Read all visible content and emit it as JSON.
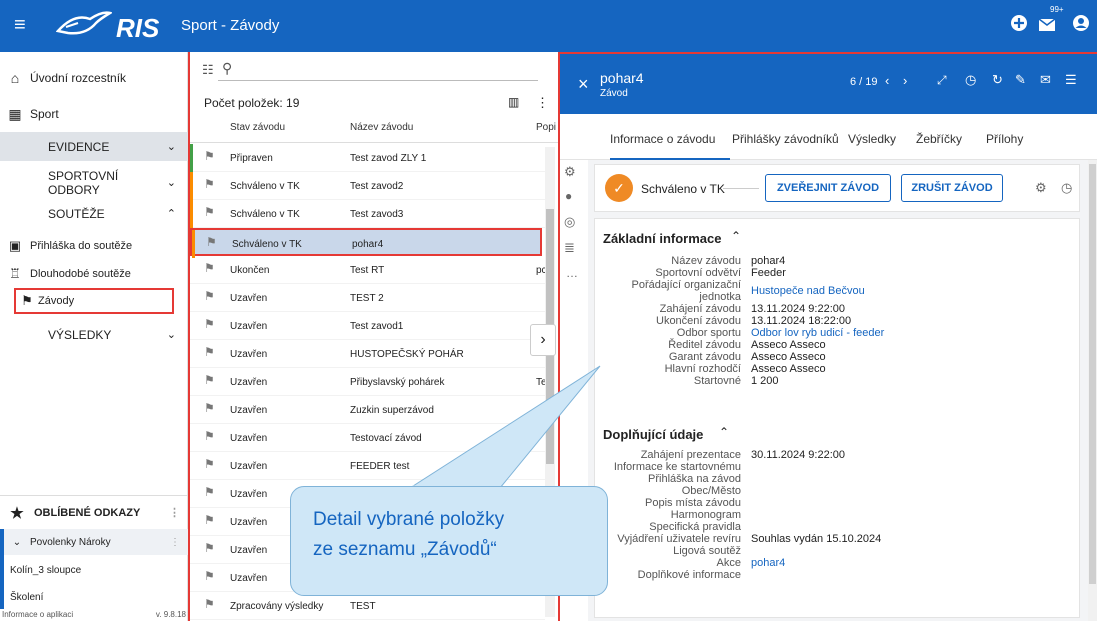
{
  "topbar": {
    "app_name": "RIS",
    "title": "Sport - Závody",
    "notif_count": "99+"
  },
  "sidebar": {
    "items": [
      {
        "label": "Úvodní rozcestník"
      },
      {
        "label": "Sport"
      }
    ],
    "sections": [
      {
        "label": "EVIDENCE"
      },
      {
        "label": "SPORTOVNÍ ODBORY"
      },
      {
        "label": "SOUTĚŽE"
      }
    ],
    "subitems": [
      {
        "label": "Přihláška do soutěže"
      },
      {
        "label": "Dlouhodobé soutěže"
      },
      {
        "label": "Závody"
      }
    ],
    "results": "VÝSLEDKY",
    "favorites": "OBLÍBENÉ ODKAZY",
    "fav_items": [
      {
        "label": "Povolenky Nároky"
      },
      {
        "label": "Kolín_3 sloupce"
      },
      {
        "label": "Školení"
      }
    ],
    "footer_left": "Informace o aplikaci",
    "footer_right": "v. 9.8.18"
  },
  "list": {
    "count": "Počet položek: 19",
    "col_status": "Stav závodu",
    "col_name": "Název závodu",
    "col_desc": "Popi",
    "rows": [
      {
        "status": "Připraven",
        "name": "Test zavod ZLY 1",
        "desc": ""
      },
      {
        "status": "Schváleno v TK",
        "name": "Test zavod2",
        "desc": ""
      },
      {
        "status": "Schváleno v TK",
        "name": "Test zavod3",
        "desc": ""
      },
      {
        "status": "Schváleno v TK",
        "name": "pohar4",
        "desc": ""
      },
      {
        "status": "Ukončen",
        "name": "Test RT",
        "desc": "pc"
      },
      {
        "status": "Uzavřen",
        "name": "TEST 2",
        "desc": ""
      },
      {
        "status": "Uzavřen",
        "name": "Test zavod1",
        "desc": ""
      },
      {
        "status": "Uzavřen",
        "name": "HUSTOPEČSKÝ POHÁR",
        "desc": ""
      },
      {
        "status": "Uzavřen",
        "name": "Přibyslavský pohárek",
        "desc": "Te"
      },
      {
        "status": "Uzavřen",
        "name": "Zuzkin superzávod",
        "desc": ""
      },
      {
        "status": "Uzavřen",
        "name": "Testovací závod",
        "desc": ""
      },
      {
        "status": "Uzavřen",
        "name": "FEEDER test",
        "desc": ""
      },
      {
        "status": "Uzavřen",
        "name": "",
        "desc": ""
      },
      {
        "status": "Uzavřen",
        "name": "",
        "desc": ""
      },
      {
        "status": "Uzavřen",
        "name": "",
        "desc": ""
      },
      {
        "status": "Uzavřen",
        "name": "",
        "desc": ""
      },
      {
        "status": "Zpracovány výsledky",
        "name": "TEST",
        "desc": ""
      }
    ],
    "status_colors": [
      "#43a047",
      "#fb8c00",
      "#fb8c00",
      "#fb8c00"
    ]
  },
  "detail": {
    "title": "pohar4",
    "subtitle": "Závod",
    "pager": "6 / 19",
    "tabs": [
      {
        "label": "Informace o závodu"
      },
      {
        "label": "Přihlášky závodníků"
      },
      {
        "label": "Výsledky"
      },
      {
        "label": "Žebříčky"
      },
      {
        "label": "Přílohy"
      }
    ],
    "status": "Schváleno v TK",
    "btn_publish": "ZVEŘEJNIT ZÁVOD",
    "btn_cancel": "ZRUŠIT ZÁVOD",
    "basic_title": "Základní informace",
    "basic": [
      {
        "k": "Název závodu",
        "v": "pohar4"
      },
      {
        "k": "Sportovní odvětví",
        "v": "Feeder"
      },
      {
        "k": "Pořádající organizační jednotka",
        "v": "Hustopeče nad Bečvou"
      },
      {
        "k": "Zahájení závodu",
        "v": "13.11.2024 9:22:00"
      },
      {
        "k": "Ukončení závodu",
        "v": "13.11.2024 18:22:00"
      },
      {
        "k": "Odbor sportu",
        "v": "Odbor lov ryb udicí - feeder"
      },
      {
        "k": "Ředitel závodu",
        "v": "Asseco Asseco"
      },
      {
        "k": "Garant závodu",
        "v": "Asseco Asseco"
      },
      {
        "k": "Hlavní rozhodčí",
        "v": "Asseco Asseco"
      },
      {
        "k": "Startovné",
        "v": "1 200"
      }
    ],
    "extra_title": "Doplňující údaje",
    "extra": [
      {
        "k": "Zahájení prezentace",
        "v": "30.11.2024 9:22:00"
      },
      {
        "k": "Informace ke startovnému",
        "v": ""
      },
      {
        "k": "Přihláška na závod",
        "v": ""
      },
      {
        "k": "Obec/Město",
        "v": ""
      },
      {
        "k": "Popis místa závodu",
        "v": ""
      },
      {
        "k": "Harmonogram",
        "v": ""
      },
      {
        "k": "Specifická pravidla",
        "v": ""
      },
      {
        "k": "Vyjádření uživatele revíru",
        "v": "Souhlas vydán 15.10.2024"
      },
      {
        "k": "Ligová soutěž",
        "v": ""
      },
      {
        "k": "Akce",
        "v": "pohar4"
      },
      {
        "k": "Doplňkové informace",
        "v": ""
      }
    ]
  },
  "callout": {
    "line1": "Detail vybrané položky",
    "line2": "ze seznamu „Závodů“"
  }
}
